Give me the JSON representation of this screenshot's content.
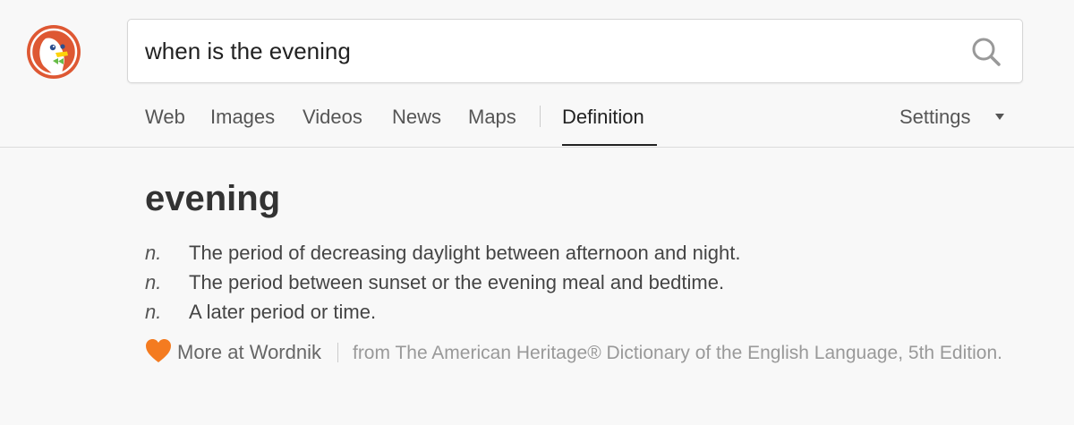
{
  "search": {
    "query": "when is the evening"
  },
  "nav": {
    "items": [
      {
        "label": "Web"
      },
      {
        "label": "Images"
      },
      {
        "label": "Videos"
      },
      {
        "label": "News"
      },
      {
        "label": "Maps"
      }
    ],
    "active_label": "Definition",
    "settings_label": "Settings"
  },
  "definition": {
    "word": "evening",
    "entries": [
      {
        "pos": "n.",
        "text": "The period of decreasing daylight between afternoon and night."
      },
      {
        "pos": "n.",
        "text": "The period between sunset or the evening meal and bedtime."
      },
      {
        "pos": "n.",
        "text": "A later period or time."
      }
    ],
    "more_link": "More at Wordnik",
    "source": "from The American Heritage® Dictionary of the English Language, 5th Edition."
  },
  "colors": {
    "logo_orange": "#de5833",
    "heart_orange": "#f47b20",
    "active_text": "#222222"
  },
  "icons": {
    "logo": "duckduckgo-logo",
    "search": "search-icon",
    "caret": "caret-down-icon",
    "heart": "heart-icon"
  }
}
